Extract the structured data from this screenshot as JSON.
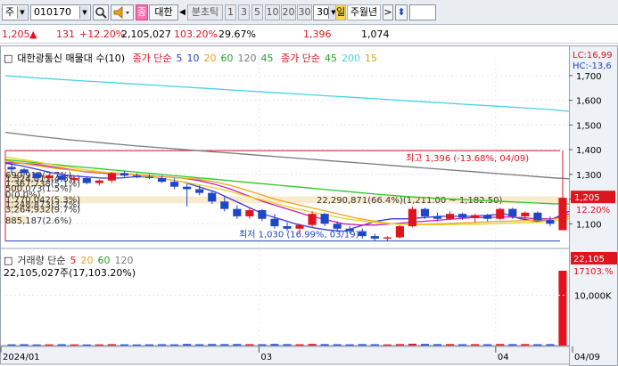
{
  "toolbar": {
    "type_value": "주",
    "code_value": "010170",
    "name_tab": "대한",
    "name_prefix": "종",
    "tick_label": "분초틱",
    "periods": [
      "1",
      "3",
      "5",
      "10",
      "20",
      "30"
    ],
    "period_selected": "30",
    "cycle_prefix": "일",
    "cycle_label": "주월년",
    "extra_value": ""
  },
  "quote": {
    "price": "1,205",
    "change": "131",
    "change_pct": "+12.20%",
    "volume": "2,105,027",
    "volume_ratio": "103.20%",
    "turnover": "29.67%",
    "high": "1,396",
    "low": "1,074"
  },
  "price_panel": {
    "legend_name": "대한광통신 매물대 수(10)",
    "legend_ma_title": "종가 단순",
    "legend_ma": [
      "5",
      "10",
      "20",
      "60",
      "120",
      "45"
    ],
    "legend_ma2_title": "종가 단순",
    "legend_ma2": [
      "45",
      "200",
      "15"
    ],
    "lc_label": "LC:16,99",
    "hc_label": "HC:-13,6",
    "current_price": "1,205",
    "current_pct": "12.20%",
    "high_note": "최고 1,396 (-13.68%, 04/09)",
    "low_note": "최저 1,030 (16.99%, 03/19)",
    "volume_profile_note": "22,290,871(66.4%)(1,211.00 ~ 1,182.50)",
    "profile_labels": [
      "690,919(2.7%)",
      "1,524,011(4.6%)",
      "1,367,738(5.1%)",
      "500,073(1.5%)",
      "0(0.0%)",
      "1,770,042(5.3%)",
      "1,248,873(3.7%)",
      "3,264,932(9.7%)",
      "885,187(2.6%)"
    ],
    "y_ticks": [
      "1,700",
      "1,600",
      "1,500",
      "1,400",
      "1,300",
      "1,200",
      "1,100"
    ]
  },
  "volume_panel": {
    "legend_title": "거래량 단순",
    "legend_ma": [
      "5",
      "20",
      "60",
      "120"
    ],
    "volume_text": "22,105,027주(17,103.20%)",
    "current_volume": "22,105",
    "current_volume_pct": "17103.%",
    "y_ticks": [
      "10,000K"
    ]
  },
  "x_axis": {
    "labels": [
      "2024/01",
      "03",
      "04",
      "04/09"
    ]
  },
  "colors": {
    "up": "#e0141e",
    "down": "#1e46c8",
    "ma5": "#3a3ad6",
    "ma10": "#c81eb4",
    "ma20": "#f0a01e",
    "ma60": "#28c828",
    "ma120": "#7a7a7a",
    "ma200": "#46d2e6",
    "ma15": "#e6d21e"
  },
  "chart_data": {
    "type": "candlestick",
    "x": [
      "2024-01",
      "2024-02",
      "2024-03",
      "2024-04-09"
    ],
    "ohlc": [
      {
        "o": 1330,
        "h": 1345,
        "l": 1305,
        "c": 1320
      },
      {
        "o": 1320,
        "h": 1325,
        "l": 1295,
        "c": 1305
      },
      {
        "o": 1305,
        "h": 1310,
        "l": 1280,
        "c": 1285
      },
      {
        "o": 1285,
        "h": 1300,
        "l": 1275,
        "c": 1295
      },
      {
        "o": 1295,
        "h": 1300,
        "l": 1270,
        "c": 1278
      },
      {
        "o": 1278,
        "h": 1290,
        "l": 1265,
        "c": 1285
      },
      {
        "o": 1285,
        "h": 1292,
        "l": 1260,
        "c": 1265
      },
      {
        "o": 1265,
        "h": 1280,
        "l": 1255,
        "c": 1275
      },
      {
        "o": 1275,
        "h": 1310,
        "l": 1265,
        "c": 1305
      },
      {
        "o": 1305,
        "h": 1315,
        "l": 1290,
        "c": 1295
      },
      {
        "o": 1295,
        "h": 1305,
        "l": 1285,
        "c": 1290
      },
      {
        "o": 1290,
        "h": 1300,
        "l": 1280,
        "c": 1285
      },
      {
        "o": 1285,
        "h": 1295,
        "l": 1265,
        "c": 1270
      },
      {
        "o": 1270,
        "h": 1285,
        "l": 1240,
        "c": 1250
      },
      {
        "o": 1250,
        "h": 1260,
        "l": 1170,
        "c": 1240
      },
      {
        "o": 1240,
        "h": 1255,
        "l": 1215,
        "c": 1225
      },
      {
        "o": 1225,
        "h": 1235,
        "l": 1180,
        "c": 1190
      },
      {
        "o": 1190,
        "h": 1210,
        "l": 1150,
        "c": 1160
      },
      {
        "o": 1160,
        "h": 1175,
        "l": 1120,
        "c": 1130
      },
      {
        "o": 1130,
        "h": 1165,
        "l": 1120,
        "c": 1155
      },
      {
        "o": 1155,
        "h": 1160,
        "l": 1110,
        "c": 1120
      },
      {
        "o": 1120,
        "h": 1140,
        "l": 1080,
        "c": 1090
      },
      {
        "o": 1090,
        "h": 1105,
        "l": 1070,
        "c": 1080
      },
      {
        "o": 1080,
        "h": 1100,
        "l": 1060,
        "c": 1095
      },
      {
        "o": 1095,
        "h": 1150,
        "l": 1085,
        "c": 1140
      },
      {
        "o": 1140,
        "h": 1145,
        "l": 1090,
        "c": 1100
      },
      {
        "o": 1100,
        "h": 1110,
        "l": 1070,
        "c": 1080
      },
      {
        "o": 1080,
        "h": 1090,
        "l": 1060,
        "c": 1070
      },
      {
        "o": 1070,
        "h": 1080,
        "l": 1040,
        "c": 1050
      },
      {
        "o": 1050,
        "h": 1060,
        "l": 1030,
        "c": 1040
      },
      {
        "o": 1040,
        "h": 1050,
        "l": 1030,
        "c": 1045
      },
      {
        "o": 1045,
        "h": 1095,
        "l": 1040,
        "c": 1090
      },
      {
        "o": 1090,
        "h": 1170,
        "l": 1085,
        "c": 1160
      },
      {
        "o": 1160,
        "h": 1165,
        "l": 1120,
        "c": 1130
      },
      {
        "o": 1130,
        "h": 1145,
        "l": 1110,
        "c": 1120
      },
      {
        "o": 1120,
        "h": 1150,
        "l": 1115,
        "c": 1140
      },
      {
        "o": 1140,
        "h": 1145,
        "l": 1115,
        "c": 1125
      },
      {
        "o": 1125,
        "h": 1140,
        "l": 1105,
        "c": 1135
      },
      {
        "o": 1135,
        "h": 1140,
        "l": 1110,
        "c": 1120
      },
      {
        "o": 1120,
        "h": 1165,
        "l": 1115,
        "c": 1160
      },
      {
        "o": 1160,
        "h": 1165,
        "l": 1120,
        "c": 1130
      },
      {
        "o": 1130,
        "h": 1150,
        "l": 1120,
        "c": 1145
      },
      {
        "o": 1145,
        "h": 1150,
        "l": 1110,
        "c": 1115
      },
      {
        "o": 1115,
        "h": 1130,
        "l": 1090,
        "c": 1100
      },
      {
        "o": 1074,
        "h": 1396,
        "l": 1074,
        "c": 1205
      }
    ],
    "series": [
      {
        "values": [
          1345,
          1335,
          1320,
          1305,
          1295,
          1290,
          1285,
          1285,
          1290,
          1290,
          1280,
          1270,
          1250,
          1230,
          1200,
          1170,
          1140,
          1120,
          1100,
          1085,
          1075,
          1070,
          1090,
          1110,
          1120,
          1120,
          1125,
          1130,
          1130,
          1130,
          1135,
          1140,
          1120,
          1110,
          1120,
          1150
        ]
      },
      {
        "values": [
          1348,
          1345,
          1340,
          1330,
          1320,
          1310,
          1305,
          1300,
          1300,
          1295,
          1290,
          1285,
          1275,
          1260,
          1240,
          1215,
          1190,
          1170,
          1150,
          1130,
          1115,
          1100,
          1095,
          1095,
          1100,
          1105,
          1110,
          1115,
          1120,
          1125,
          1125,
          1128,
          1125,
          1120,
          1120,
          1140
        ]
      },
      {
        "values": [
          1355,
          1345,
          1335,
          1325,
          1318,
          1312,
          1308,
          1305,
          1300,
          1295,
          1290,
          1285,
          1280,
          1270,
          1255,
          1235,
          1215,
          1195,
          1180,
          1165,
          1150,
          1135,
          1120,
          1110,
          1100,
          1098,
          1098,
          1100,
          1102,
          1105,
          1108,
          1110,
          1112,
          1115,
          1118,
          1130
        ]
      },
      {
        "values": [
          1360,
          1353,
          1346,
          1340,
          1334,
          1328,
          1322,
          1316,
          1310,
          1304,
          1298,
          1292,
          1286,
          1280,
          1274,
          1268,
          1262,
          1256,
          1250,
          1244,
          1238,
          1232,
          1226,
          1220,
          1215,
          1210,
          1206,
          1202,
          1199,
          1196,
          1193,
          1190,
          1187,
          1184,
          1181,
          1180
        ]
      },
      {
        "values": [
          1470,
          1462,
          1454,
          1447,
          1440,
          1434,
          1428,
          1422,
          1416,
          1411,
          1406,
          1401,
          1396,
          1391,
          1386,
          1381,
          1376,
          1371,
          1366,
          1361,
          1356,
          1351,
          1346,
          1341,
          1336,
          1331,
          1326,
          1321,
          1316,
          1311,
          1306,
          1301,
          1296,
          1291,
          1286,
          1282
        ]
      },
      {
        "values": [
          1700,
          1695,
          1690,
          1686,
          1682,
          1678,
          1674,
          1670,
          1666,
          1662,
          1658,
          1654,
          1650,
          1646,
          1642,
          1638,
          1634,
          1630,
          1626,
          1622,
          1618,
          1614,
          1610,
          1606,
          1602,
          1598,
          1594,
          1590,
          1586,
          1582,
          1578,
          1574,
          1570,
          1566,
          1562,
          1555
        ]
      },
      {
        "values": [
          1370,
          1360,
          1350,
          1338,
          1328,
          1318,
          1310,
          1302,
          1296,
          1290,
          1280,
          1270,
          1258,
          1245,
          1230,
          1212,
          1195,
          1178,
          1162,
          1148,
          1135,
          1122,
          1112,
          1105,
          1100,
          1097,
          1096,
          1096,
          1097,
          1098,
          1100,
          1102,
          1104,
          1106,
          1110,
          1120
        ]
      }
    ],
    "volume": [
      5,
      6,
      4,
      5,
      6,
      5,
      4,
      5,
      7,
      5,
      4,
      5,
      6,
      5,
      9,
      6,
      8,
      7,
      8,
      7,
      6,
      9,
      7,
      6,
      10,
      7,
      6,
      5,
      7,
      6,
      5,
      8,
      12,
      9,
      7,
      8,
      6,
      7,
      6,
      9,
      7,
      8,
      6,
      7,
      22105
    ],
    "ylim": [
      1000,
      1750
    ],
    "volume_ylim": [
      0,
      22105
    ]
  }
}
